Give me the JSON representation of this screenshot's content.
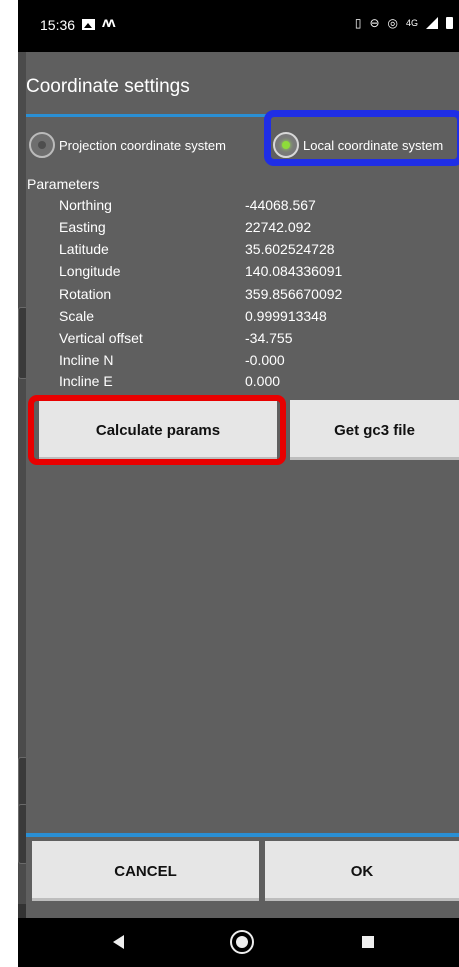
{
  "status_bar": {
    "time": "15:36",
    "network": "4G"
  },
  "dialog": {
    "title": "Coordinate settings",
    "radio_options": [
      {
        "label": "Projection coordinate system",
        "checked": false
      },
      {
        "label": "Local coordinate system",
        "checked": true
      }
    ],
    "parameters_heading": "Parameters",
    "parameters": [
      {
        "label": "Northing",
        "value": "-44068.567"
      },
      {
        "label": "Easting",
        "value": "22742.092"
      },
      {
        "label": "Latitude",
        "value": "35.602524728"
      },
      {
        "label": "Longitude",
        "value": "140.084336091"
      },
      {
        "label": "Rotation",
        "value": "359.856670092"
      },
      {
        "label": "Scale",
        "value": "0.999913348"
      },
      {
        "label": "Vertical offset",
        "value": "-34.755"
      },
      {
        "label": "Incline N",
        "value": "-0.000"
      },
      {
        "label": "Incline E",
        "value": "0.000"
      }
    ],
    "calculate_label": "Calculate params",
    "gc3_label": "Get gc3 file",
    "cancel_label": "CANCEL",
    "ok_label": "OK"
  },
  "colors": {
    "accent_blue": "#2a8fd4",
    "highlight_red": "#e80000",
    "highlight_blue": "#1f2ee6",
    "radio_checked": "#8edc3a"
  }
}
